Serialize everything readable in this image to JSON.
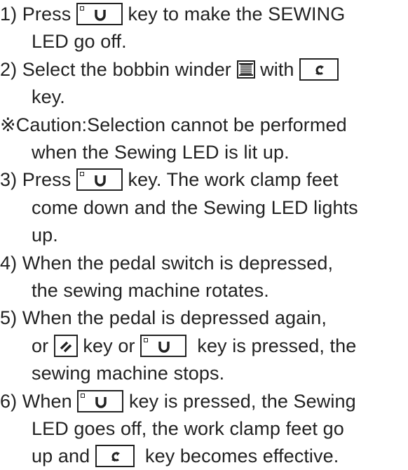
{
  "steps": {
    "s1": {
      "pre": "1) Press ",
      "post": " key to make the SEWING",
      "cont": "LED go off."
    },
    "s2": {
      "pre": "2) Select the bobbin winder ",
      "mid": " with ",
      "cont": "key."
    },
    "caution": {
      "line1": "※Caution:Selection cannot be performed",
      "line2": "when the Sewing LED is lit up."
    },
    "s3": {
      "pre": "3) Press ",
      "post": " key. The work clamp feet",
      "cont1": "come down and the Sewing LED lights",
      "cont2": "up."
    },
    "s4": {
      "line1": "4) When the pedal switch is depressed,",
      "line2": "the sewing machine rotates."
    },
    "s5": {
      "line1": "5) When the pedal is depressed again,",
      "pre": "or ",
      "mid": " key or ",
      "post": "  key is pressed, the",
      "cont": "sewing machine stops."
    },
    "s6": {
      "pre": "6) When ",
      "post": " key is pressed, the Sewing",
      "cont1": "LED goes off, the work clamp feet go",
      "pre2": "up and ",
      "post2": "  key becomes effective."
    }
  },
  "icons": {
    "ready_key": "ready-key-icon",
    "winder_key": "winder-key-icon",
    "bobbin": "bobbin-icon",
    "thread_key": "thread-clamp-key-icon"
  }
}
